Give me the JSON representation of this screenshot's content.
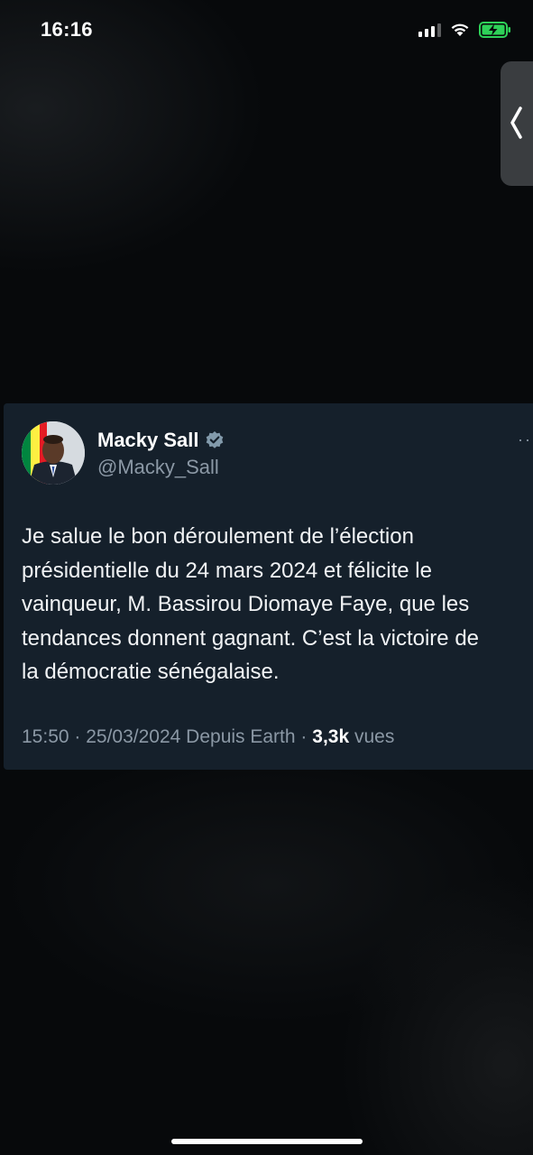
{
  "status_bar": {
    "time": "16:16"
  },
  "tweet": {
    "author_name": "Macky Sall",
    "author_handle": "@Macky_Sall",
    "verified": true,
    "more_label": "···",
    "text_lines": [
      "Je salue le bon déroulement de l’élection",
      "présidentielle du 24 mars 2024 et félicite le",
      "vainqueur, M. Bassirou Diomaye Faye, que les",
      "tendances donnent gagnant. C’est la victoire de",
      "la démocratie sénégalaise."
    ],
    "meta": {
      "time_date": "15:50 · 25/03/2024",
      "source": "Depuis Earth",
      "separator": "·",
      "views_count": "3,3k",
      "views_label": "vues"
    }
  },
  "colors": {
    "card_background": "#15202b",
    "secondary_text": "#8b98a5",
    "verified_badge": "#829aab"
  },
  "icons": {
    "signal": "cellular-signal-icon",
    "wifi": "wifi-icon",
    "battery": "battery-charging-icon",
    "verified": "verified-badge-icon",
    "side_handle": "chevron-left-icon"
  }
}
